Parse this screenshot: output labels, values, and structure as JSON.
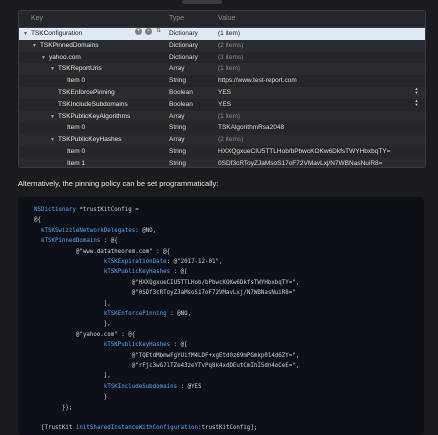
{
  "plist": {
    "headers": {
      "key": "Key",
      "type": "Type",
      "value": "Value"
    },
    "rows": [
      {
        "key": "TSKConfiguration",
        "type": "Dictionary",
        "value": "(1 item)",
        "indent": 0,
        "disclosure": "open",
        "selected": true,
        "dim": true
      },
      {
        "key": "TSKPinnedDomains",
        "type": "Dictionary",
        "value": "(2 items)",
        "indent": 1,
        "disclosure": "open",
        "dim": true
      },
      {
        "key": "yahoo.com",
        "type": "Dictionary",
        "value": "(3 items)",
        "indent": 2,
        "disclosure": "open",
        "dim": true
      },
      {
        "key": "TSKReportUris",
        "type": "Array",
        "value": "(1 item)",
        "indent": 3,
        "disclosure": "open",
        "dim": true
      },
      {
        "key": "Item 0",
        "type": "String",
        "value": "https://www.test-report.com",
        "indent": 4
      },
      {
        "key": "TSKEnforcePinning",
        "type": "Boolean",
        "value": "YES",
        "indent": 3,
        "stepper": true
      },
      {
        "key": "TSKIncludeSubdomains",
        "type": "Boolean",
        "value": "YES",
        "indent": 3,
        "stepper": true
      },
      {
        "key": "TSKPublicKeyAlgorithms",
        "type": "Array",
        "value": "(1 item)",
        "indent": 3,
        "disclosure": "open",
        "dim": true
      },
      {
        "key": "Item 0",
        "type": "String",
        "value": "TSKAlgorithmRsa2048",
        "indent": 4
      },
      {
        "key": "TSKPublicKeyHashes",
        "type": "Array",
        "value": "(2 items)",
        "indent": 3,
        "disclosure": "open",
        "dim": true
      },
      {
        "key": "Item 0",
        "type": "String",
        "value": "HXXQgxueCIU5TTLHob/bPbwcKOKw6DkfsTWYHbxbqTY=",
        "indent": 4
      },
      {
        "key": "Item 1",
        "type": "String",
        "value": "0SDf3cRToyZJaMsoS17oF72VMavLxj/N7WBNasNuiR8=",
        "indent": 4
      },
      {
        "key": "www.datatheorem.com",
        "type": "Dictionary",
        "value": "(5 items)",
        "indent": 2,
        "disclosure": "closed",
        "dim": true
      }
    ]
  },
  "prose": "Alternatively, the pinning policy can be set programmatically:",
  "code": [
    [
      [
        "tk",
        "NSDictionary"
      ],
      [
        "cl",
        " *trustKitConfig ="
      ]
    ],
    [
      [
        "cl",
        "@{"
      ]
    ],
    [
      [
        "cl",
        "  "
      ],
      [
        "tk",
        "kTSKSwizzleNetworkDelegates"
      ],
      [
        "cl",
        ": @NO,"
      ]
    ],
    [
      [
        "cl",
        "  "
      ],
      [
        "tk",
        "kTSKPinnedDomains"
      ],
      [
        "cl",
        " : @{"
      ]
    ],
    [
      [
        "cl",
        "            @\"www.datatheorem.com\" : @{"
      ]
    ],
    [
      [
        "cl",
        "                    "
      ],
      [
        "tk",
        "kTSKExpirationDate"
      ],
      [
        "cl",
        ": @\"2017-12-01\","
      ]
    ],
    [
      [
        "cl",
        "                    "
      ],
      [
        "tk",
        "kTSKPublicKeyHashes"
      ],
      [
        "cl",
        " : @["
      ]
    ],
    [
      [
        "cl",
        "                            @\"HXXQgxueCIU5TTLHob/bPbwcKOKw6DkfsTWYHbxbqTY=\","
      ]
    ],
    [
      [
        "cl",
        "                            @\"0SDf3cRToyZJaMsoS17oF72VMavLxj/N7WBNasNuiR8=\""
      ]
    ],
    [
      [
        "cl",
        "                    ],"
      ]
    ],
    [
      [
        "cl",
        "                    "
      ],
      [
        "tk",
        "kTSKEnforcePinning"
      ],
      [
        "cl",
        " : @NO,"
      ]
    ],
    [
      [
        "cl",
        "                    },"
      ]
    ],
    [
      [
        "cl",
        "            @\"yahoo.com\" : @{"
      ]
    ],
    [
      [
        "cl",
        "                    "
      ],
      [
        "tk",
        "kTSKPublicKeyHashes"
      ],
      [
        "cl",
        " : @["
      ]
    ],
    [
      [
        "cl",
        "                            @\"TQEtdMbmwFgYUifM4LDF+xgEtd0z69mPGmkp014d6ZY=\","
      ]
    ],
    [
      [
        "cl",
        "                            @\"rFjc3wG7lTZe43zeYTvPq8k4xdDEutCmIhI5dn4oCeE=\","
      ]
    ],
    [
      [
        "cl",
        "                    ],"
      ]
    ],
    [
      [
        "cl",
        "                    "
      ],
      [
        "tk",
        "kTSKIncludeSubdomains"
      ],
      [
        "cl",
        " : @YES"
      ]
    ],
    [
      [
        "cl",
        "                    }"
      ]
    ],
    [
      [
        "cl",
        "        }};"
      ]
    ],
    [
      [
        "cl",
        ""
      ]
    ],
    [
      [
        "cl",
        "  [TrustKit "
      ],
      [
        "tk",
        "initSharedInstanceWithConfiguration"
      ],
      [
        "cl",
        ":trustKitConfig];"
      ]
    ]
  ]
}
